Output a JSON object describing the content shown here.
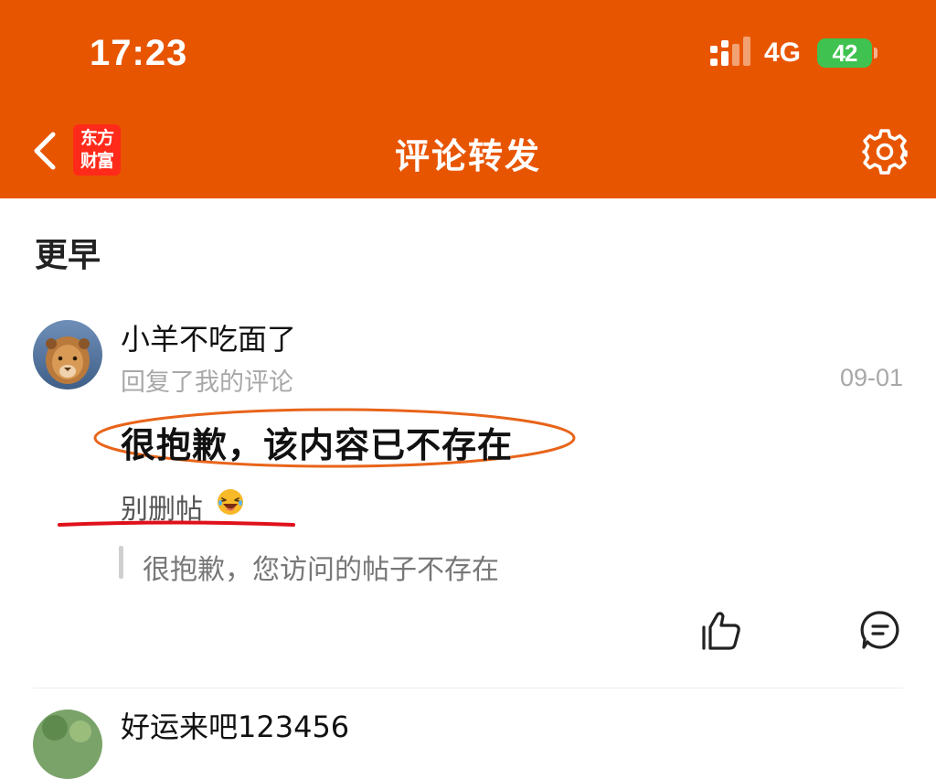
{
  "status_bar": {
    "time": "17:23",
    "network": "4G",
    "battery": "42"
  },
  "nav": {
    "title": "评论转发",
    "logo_line1": "东方",
    "logo_line2": "财富",
    "back_icon": "chevron-left-icon",
    "settings_icon": "gear-icon"
  },
  "section": {
    "label": "更早"
  },
  "items": [
    {
      "username": "小羊不吃面了",
      "action": "回复了我的评论",
      "date": "09-01",
      "notice": "很抱歉，该内容已不存在",
      "reply": "别删帖",
      "reply_emoji": "laughing-face",
      "quote": "很抱歉，您访问的帖子不存在"
    },
    {
      "username": "好运来吧123456"
    }
  ],
  "colors": {
    "header_bg": "#e85500",
    "battery": "#3fc24f",
    "logo_bg": "#ff2a1a",
    "annotation_ellipse": "#e8641a",
    "annotation_underline": "#e0101a"
  }
}
